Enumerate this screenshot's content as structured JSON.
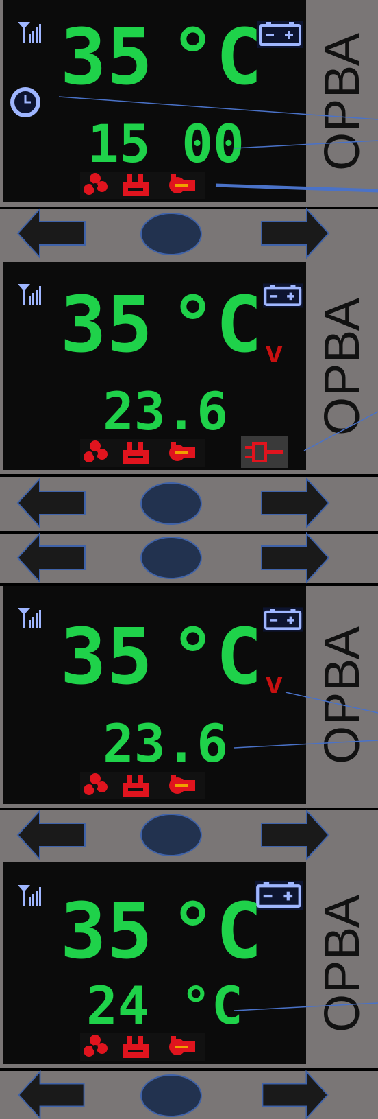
{
  "side_label": "ОРВА",
  "screens": [
    {
      "temp": "35",
      "unit": "°C",
      "secondary": "15 00"
    },
    {
      "temp": "35",
      "unit": "°C",
      "secondary": "23.6",
      "volt": "v"
    },
    {
      "temp": "35",
      "unit": "°C",
      "secondary": "23.6",
      "volt": "v"
    },
    {
      "temp": "35",
      "unit": "°C",
      "secondary": "24 °C"
    }
  ],
  "colors": {
    "digits": "#1fd24a",
    "icons": "#9fb6ff",
    "alerts": "#e0141e",
    "arrows": "#1a1a1a",
    "button": "#22324f"
  },
  "icons": [
    "signal-icon",
    "battery-icon",
    "clock-icon",
    "fan-icon",
    "engine-icon",
    "pump-icon",
    "plug-icon",
    "arrow-left-icon",
    "arrow-right-icon"
  ]
}
